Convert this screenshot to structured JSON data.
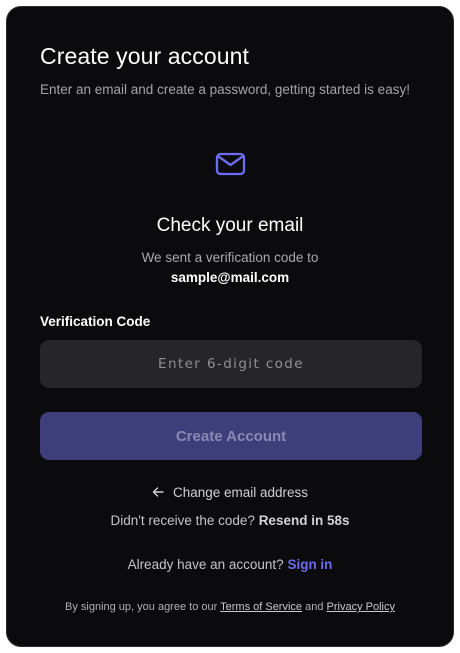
{
  "header": {
    "title": "Create your account",
    "subtitle": "Enter an email and create a password, getting started is easy!"
  },
  "verification": {
    "icon": "mail-icon",
    "title": "Check your email",
    "sent_text": "We sent a verification code to",
    "email": "sample@mail.com"
  },
  "form": {
    "code_label": "Verification Code",
    "code_placeholder": "Enter 6-digit code",
    "code_value": "",
    "submit_label": "Create Account"
  },
  "links": {
    "change_email_label": "Change email address",
    "resend_prefix": "Didn't receive the code?",
    "resend_label": "Resend in 58s",
    "signin_prefix": "Already have an account?",
    "signin_label": "Sign in"
  },
  "footer": {
    "prefix": "By signing up, you agree to our",
    "terms_label": "Terms of Service",
    "and_text": "and",
    "privacy_label": "Privacy Policy"
  },
  "colors": {
    "card_background": "#0b0b0d",
    "accent": "#6b6cf0",
    "button_disabled": "#3d3e7a",
    "input_background": "#262628"
  }
}
